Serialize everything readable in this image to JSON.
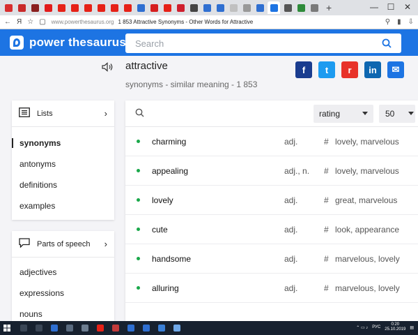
{
  "browser": {
    "tab_colors": [
      "#d82e2e",
      "#c92a2a",
      "#8a1f1f",
      "#e21b1b",
      "#e62117",
      "#e62117",
      "#e62117",
      "#e62117",
      "#e62117",
      "#e62117",
      "#2f6fd1",
      "#d61e1e",
      "#e62117",
      "#cf1f2e",
      "#444444",
      "#2f6fd1",
      "#2f6fd1",
      "#c0c0c0",
      "#999999",
      "#2f6fd1",
      "#1d74e3",
      "#555555",
      "#2e8b3a",
      "#7a7a7a"
    ],
    "new_tab_label": "+",
    "url": "www.powerthesaurus.org",
    "page_title": "1 853 Attractive Synonyms - Other Words for Attractive"
  },
  "header": {
    "logo_text": "power thesaurus",
    "search_placeholder": "Search",
    "accent_color": "#1d74e3"
  },
  "word": {
    "title": "attractive",
    "subtitle": "synonyms - similar meaning - 1 853"
  },
  "share": [
    {
      "name": "facebook",
      "glyph": "f",
      "color": "#1a3c8f"
    },
    {
      "name": "twitter",
      "glyph": "t",
      "color": "#1d9bf0"
    },
    {
      "name": "reddit",
      "glyph": "r",
      "color": "#e8322a"
    },
    {
      "name": "linkedin",
      "glyph": "in",
      "color": "#0e66b0"
    },
    {
      "name": "email",
      "glyph": "✉",
      "color": "#1d74e3"
    }
  ],
  "sidebar": {
    "lists_label": "Lists",
    "lists": [
      "synonyms",
      "antonyms",
      "definitions",
      "examples"
    ],
    "pos_label": "Parts of speech",
    "pos": [
      "adjectives",
      "expressions",
      "nouns"
    ]
  },
  "results": {
    "sort_value": "rating",
    "count_value": "50",
    "rows": [
      {
        "word": "charming",
        "pos": "adj.",
        "tags": "lovely, marvelous"
      },
      {
        "word": "appealing",
        "pos": "adj., n.",
        "tags": "lovely, marvelous"
      },
      {
        "word": "lovely",
        "pos": "adj.",
        "tags": "great, marvelous"
      },
      {
        "word": "cute",
        "pos": "adj.",
        "tags": "look, appearance"
      },
      {
        "word": "handsome",
        "pos": "adj.",
        "tags": "marvelous, lovely"
      },
      {
        "word": "alluring",
        "pos": "adj.",
        "tags": "marvelous, lovely"
      }
    ]
  },
  "taskbar": {
    "lang": "РУС",
    "time": "0:20",
    "date": "25.10.2019"
  }
}
